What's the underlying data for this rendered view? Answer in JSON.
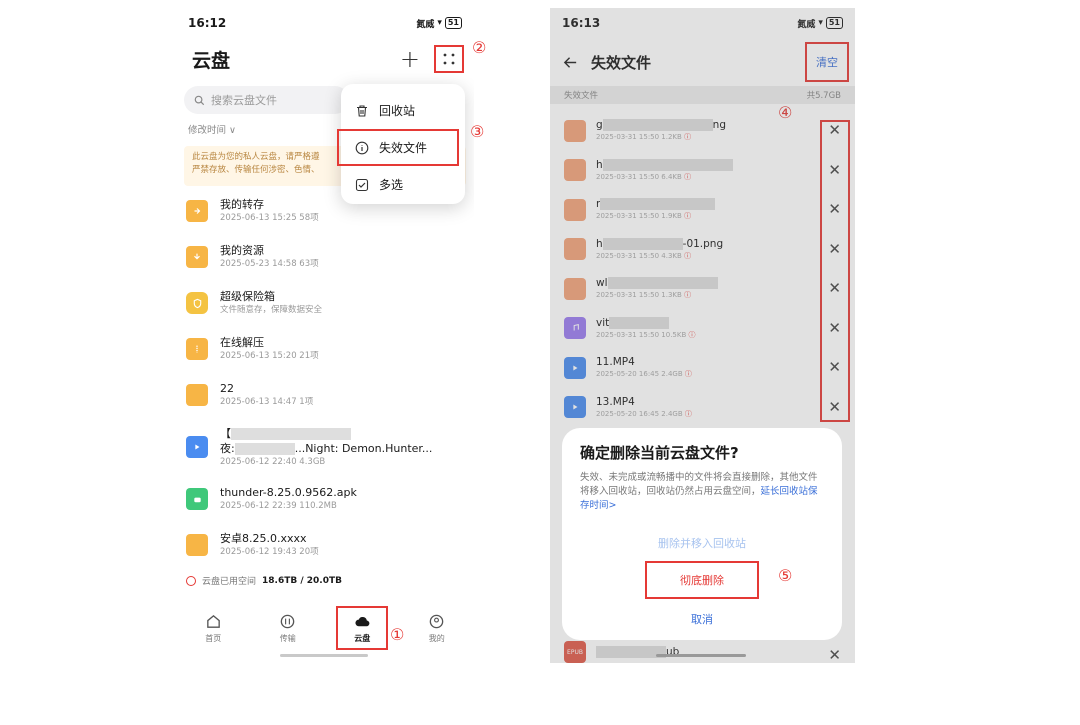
{
  "left": {
    "status": {
      "time": "16:12",
      "signal": "氮威",
      "battery": "51"
    },
    "header": {
      "title": "云盘",
      "plus": "+"
    },
    "annotations": {
      "grid": "②",
      "menu": "③",
      "nav": "①"
    },
    "search": {
      "placeholder": "搜索云盘文件"
    },
    "sort": {
      "label": "修改时间 ∨"
    },
    "notice": "此云盘为您的私人云盘，请严格遵\n严禁存放、传输任何涉密、色情、",
    "files": [
      {
        "name": "我的转存",
        "meta": "2025-06-13 15:25  58项"
      },
      {
        "name": "我的资源",
        "meta": "2025-05-23 14:58  63项"
      },
      {
        "name": "超级保险箱",
        "meta": "文件随意存，保障数据安全"
      },
      {
        "name": "在线解压",
        "meta": "2025-06-13 15:20  21项"
      },
      {
        "name": "22",
        "meta": "2025-06-13 14:47  1项"
      },
      {
        "name_start": "【",
        "name_line2_start": "夜:",
        "name_line2_end": "...Night: Demon.Hunter...",
        "meta": "2025-06-12 22:40  4.3GB"
      },
      {
        "name": "thunder-8.25.0.9562.apk",
        "meta": "2025-06-12 22:39  110.2MB"
      },
      {
        "name": "安卓8.25.0.xxxx",
        "meta": "2025-06-12 19:43  20项"
      }
    ],
    "storage": {
      "label": "云盘已用空间",
      "value": "18.6TB / 20.0TB"
    },
    "nav": [
      {
        "label": "首页"
      },
      {
        "label": "传输"
      },
      {
        "label": "云盘"
      },
      {
        "label": "我的"
      }
    ],
    "menu": [
      {
        "label": "回收站"
      },
      {
        "label": "失效文件"
      },
      {
        "label": "多选"
      }
    ]
  },
  "right": {
    "status": {
      "time": "16:13",
      "signal": "氮威",
      "battery": "51"
    },
    "header": {
      "title": "失效文件",
      "clear": "清空"
    },
    "annotation_x": "④",
    "annotation_delete": "⑤",
    "subhead": {
      "left": "失效文件",
      "right": "共5.7GB"
    },
    "files": [
      {
        "name": "g",
        "name_end": "ng",
        "meta": "2025-03-31 15:50  1.2KB",
        "type": "img"
      },
      {
        "name": "h",
        "meta": "2025-03-31 15:50  6.4KB",
        "type": "img"
      },
      {
        "name": "r",
        "meta": "2025-03-31 15:50  1.9KB",
        "type": "img"
      },
      {
        "name": "h",
        "name_end": "-01.png",
        "meta": "2025-03-31 15:50  4.3KB",
        "type": "img"
      },
      {
        "name": "wl",
        "meta": "2025-03-31 15:50  1.3KB",
        "type": "img"
      },
      {
        "name": "vit",
        "meta": "2025-03-31 15:50  10.5KB",
        "type": "music"
      },
      {
        "name": "11.MP4",
        "meta": "2025-05-20 16:45  2.4GB",
        "type": "video"
      },
      {
        "name": "13.MP4",
        "meta": "2025-05-20 16:45  2.4GB",
        "type": "video"
      }
    ],
    "epub": {
      "label": "EPUB",
      "name_end": "ub"
    },
    "dialog": {
      "title": "确定删除当前云盘文件?",
      "desc": "失效、未完成或流畅播中的文件将会直接删除，其他文件将移入回收站，回收站仍然占用云盘空间，",
      "link": "延长回收站保存时间>",
      "option1": "删除并移入回收站",
      "option2": "彻底删除",
      "cancel": "取消"
    }
  },
  "colors": {
    "highlight": "#e53935",
    "accent": "#3a6fd8",
    "folder": "#f7b545"
  }
}
